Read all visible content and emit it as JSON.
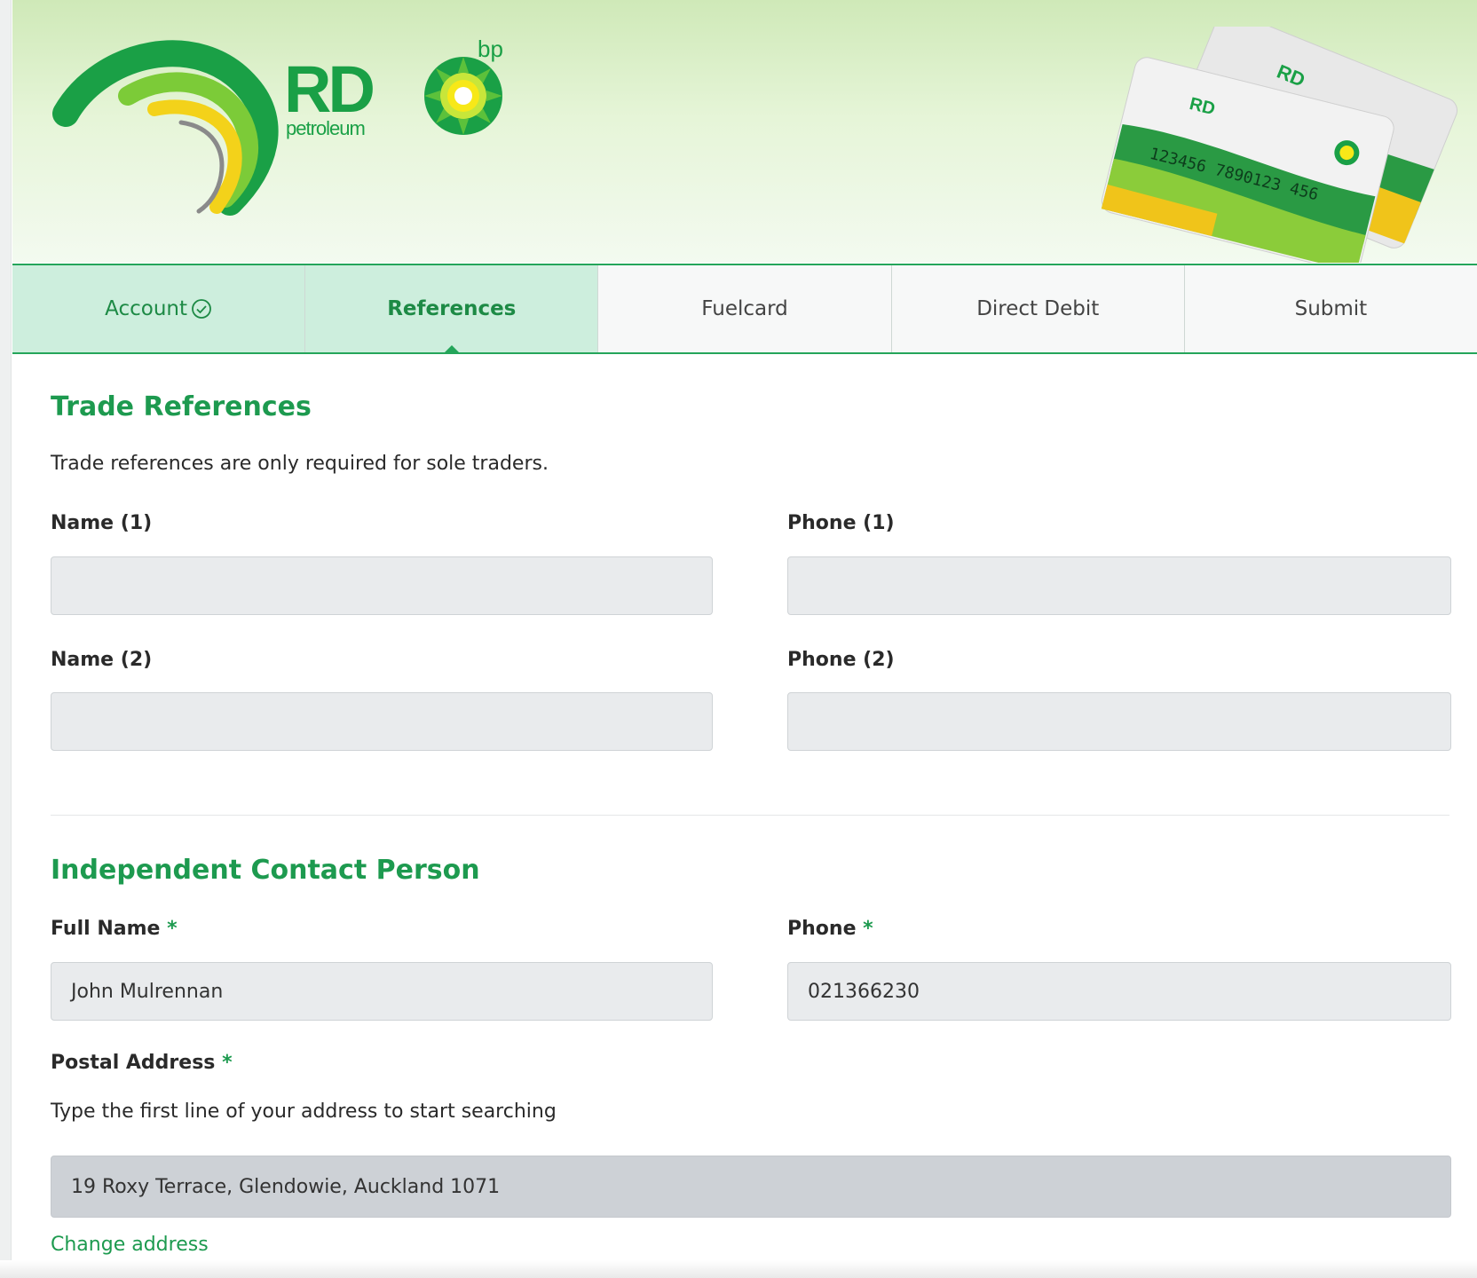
{
  "brand": {
    "rd": "RD",
    "petroleum": "petroleum",
    "bp": "bp",
    "colors": {
      "primary": "#1d9a4f",
      "yellow": "#f3d21a"
    }
  },
  "tabs": [
    {
      "label": "Account",
      "state": "done",
      "icon": "check-circle-icon"
    },
    {
      "label": "References",
      "state": "active"
    },
    {
      "label": "Fuelcard",
      "state": "pending"
    },
    {
      "label": "Direct Debit",
      "state": "pending"
    },
    {
      "label": "Submit",
      "state": "pending"
    }
  ],
  "trade_references": {
    "title": "Trade References",
    "help": "Trade references are only required for sole traders.",
    "name1_label": "Name (1)",
    "phone1_label": "Phone (1)",
    "name2_label": "Name (2)",
    "phone2_label": "Phone (2)",
    "name1_value": "",
    "phone1_value": "",
    "name2_value": "",
    "phone2_value": ""
  },
  "independent_contact": {
    "title": "Independent Contact Person",
    "full_name_label": "Full Name",
    "phone_label": "Phone",
    "required_mark": "*",
    "full_name_value": "John Mulrennan",
    "phone_value": "021366230",
    "postal_label": "Postal Address",
    "postal_help": "Type the first line of your address to start searching",
    "postal_value": "19 Roxy Terrace, Glendowie, Auckland 1071",
    "change_address": "Change address"
  }
}
